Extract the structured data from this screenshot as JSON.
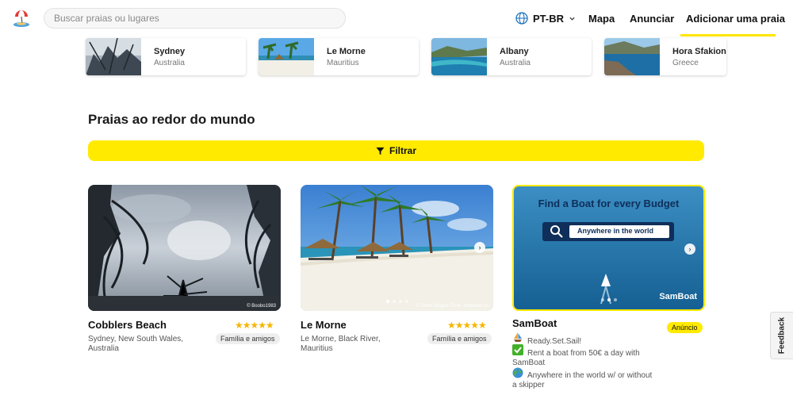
{
  "header": {
    "search_placeholder": "Buscar praias ou lugares",
    "language": "PT-BR",
    "nav": [
      "Mapa",
      "Anunciar",
      "Adicionar uma praia"
    ]
  },
  "places": [
    {
      "name": "Sydney",
      "country": "Australia"
    },
    {
      "name": "Le Morne",
      "country": "Mauritius"
    },
    {
      "name": "Albany",
      "country": "Australia"
    },
    {
      "name": "Hora Sfakion",
      "country": "Greece"
    }
  ],
  "section": {
    "title": "Praias ao redor do mundo",
    "filter_label": "Filtrar"
  },
  "cards": [
    {
      "title": "Cobblers Beach",
      "location": "Sydney, New South Wales, Australia",
      "rating": 5,
      "stars": "★★★★★",
      "tag": "Família e amigos",
      "credit": "© Boobo1983"
    },
    {
      "title": "Le Morne",
      "location": "Le Morne, Black River, Mauritius",
      "rating": 5,
      "stars": "★★★★★",
      "tag": "Família e amigos",
      "credit": "© Svein-Magne Tunli - tunliweb.no"
    }
  ],
  "ad": {
    "title": "SamBoat",
    "badge": "Anúncio",
    "banner_heading": "Find a Boat for every Budget",
    "banner_search": "Anywhere in the world",
    "banner_logo": "SamBoat",
    "lines": [
      "Ready.Set.Sail!",
      "Rent a boat from 50€ a day with SamBoat",
      "Anywhere in the world w/ or without a skipper"
    ]
  },
  "feedback_label": "Feedback",
  "colors": {
    "accent": "#ffea00",
    "star": "#f7b500"
  }
}
